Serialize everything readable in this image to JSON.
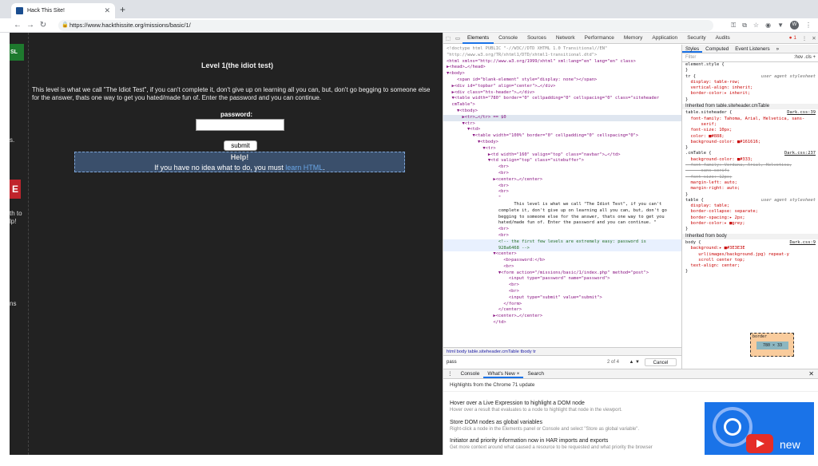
{
  "browser": {
    "tab_title": "Hack This Site!",
    "url": "https://www.hackthissite.org/missions/basic/1/"
  },
  "page": {
    "left_sl": "SL",
    "left_s": "s.",
    "left_e": "E",
    "left_th_to": "th to",
    "left_lp": "lp!",
    "left_ns": "ns",
    "title": "Level 1(the idiot test)",
    "body": "This level is what we call \"The Idiot Test\", if you can't complete it, don't give up on learning all you can, but, don't go begging to someone else for the answer, thats one way to get you hated/made fun of. Enter the password and you can continue.",
    "password_label": "password:",
    "submit_label": "submit",
    "help": "Help!",
    "idea_prefix": "If you have no idea what to do, you must ",
    "idea_link": "learn HTML",
    "idea_suffix": "."
  },
  "devtools": {
    "tabs": [
      "Elements",
      "Console",
      "Sources",
      "Network",
      "Performance",
      "Memory",
      "Application",
      "Security",
      "Audits"
    ],
    "error_count": "1",
    "dom_lines": [
      {
        "t": "<!doctype html PUBLIC \"-//W3C//DTD XHTML 1.0 Transitional//EN\"",
        "cls": "cm-grey"
      },
      {
        "t": "\"http://www.w3.org/TR/xhtml1/DTD/xhtml1-transitional.dtd\">",
        "cls": "cm-grey"
      },
      {
        "t": "<html xmlns=\"http://www.w3.org/1999/xhtml\" xml:lang=\"en\" lang=\"en\" class>"
      },
      {
        "t": "▶<head>…</head>"
      },
      {
        "t": "▼<body>"
      },
      {
        "t": "    <span id=\"blank-element\" style=\"display: none\"></span>"
      },
      {
        "t": "  ▶<div id=\"topbar\" align=\"center\">…</div>"
      },
      {
        "t": "  ▶<div class=\"hts-header\">…</div>"
      },
      {
        "t": "  ▼<table width=\"780\" border=\"0\" cellpadding=\"0\" cellspacing=\"0\" class=\"siteheader"
      },
      {
        "t": "  cmTable\">"
      },
      {
        "t": "    ▼<tbody>"
      },
      {
        "t": "      ▶<tr>…</tr> == $0",
        "sel": true
      },
      {
        "t": "      ▼<tr>"
      },
      {
        "t": "        ▼<td>"
      },
      {
        "t": "          ▼<table width=\"100%\" border=\"0\" cellpadding=\"0\" cellspacing=\"0\">"
      },
      {
        "t": "            ▼<tbody>"
      },
      {
        "t": "              ▼<tr>"
      },
      {
        "t": "                ▶<td width=\"160\" valign=\"top\" class=\"navbar\">…</td>"
      },
      {
        "t": "                ▼<td valign=\"top\" class=\"sitebuffer\">"
      },
      {
        "t": "                    <br>"
      },
      {
        "t": "                    <br>"
      },
      {
        "t": "                  ▶<center>…</center>"
      },
      {
        "t": "                    <br>"
      },
      {
        "t": "                    <br>"
      },
      {
        "t": "                    \""
      },
      {
        "t": ""
      },
      {
        "t": "                          This level is what we call \"The Idiot Test\", if you can't",
        "tx": true
      },
      {
        "t": "                    complete it, don't give up on learning all you can, but, don't go",
        "tx": true
      },
      {
        "t": "                    begging to someone else for the answer, thats one way to get you",
        "tx": true
      },
      {
        "t": "                    hated/made fun of. Enter the password and you can continue. \"",
        "tx": true
      },
      {
        "t": "                    <br>"
      },
      {
        "t": "                    <br>"
      },
      {
        "t": "                    <!-- the first few levels are extremely easy: password is",
        "cm": true,
        "hl": true
      },
      {
        "t": "                    928a6468 -->",
        "cm": true,
        "hl": true
      },
      {
        "t": "                  ▼<center>"
      },
      {
        "t": "                      <b>password:</b>"
      },
      {
        "t": "                      <br>"
      },
      {
        "t": "                    ▼<form action=\"/missions/basic/1/index.php\" method=\"post\">"
      },
      {
        "t": "                        <input type=\"password\" name=\"password\">"
      },
      {
        "t": "                        <br>"
      },
      {
        "t": "                        <br>"
      },
      {
        "t": "                        <input type=\"submit\" value=\"submit\">"
      },
      {
        "t": "                      </form>"
      },
      {
        "t": "                    </center>"
      },
      {
        "t": "                  ▶<center>…</center>"
      },
      {
        "t": "                  </td>"
      }
    ],
    "breadcrumbs": "html   body   table.siteheader.cmTable   tbody   tr",
    "search_value": "pass",
    "search_count": "2 of 4",
    "cancel_label": "Cancel",
    "styles_tabs": [
      "Styles",
      "Computed",
      "Event Listeners",
      "»"
    ],
    "filter_placeholder": "Filter",
    "filter_right": ":hov  .cls  +",
    "style_lines": [
      {
        "t": "element.style {"
      },
      {
        "t": "}"
      },
      {
        "t": "tr {",
        "ua": "user agent stylesheet"
      },
      {
        "t": "  display: table-row;",
        "p": true
      },
      {
        "t": "  vertical-align: inherit;",
        "p": true
      },
      {
        "t": "  border-color:▸ inherit;",
        "p": true
      },
      {
        "t": "}"
      },
      {
        "inh": "Inherited from table.siteheader.cmTable"
      },
      {
        "t": "table.siteheader {",
        "src": "Dark.css:39"
      },
      {
        "t": "  font-family: Tahoma, Arial, Helvetica, sans-",
        "p": true
      },
      {
        "t": "      serif;",
        "p": true
      },
      {
        "t": "  font-size: 10px;",
        "p": true
      },
      {
        "t": "  color: ■#888;",
        "p": true
      },
      {
        "t": "  background-color: ■#161616;",
        "p": true
      },
      {
        "t": "}"
      },
      {
        "t": ".cmTable {",
        "src": "Dark.css:237"
      },
      {
        "t": "  background-color: ■#333;",
        "p": true
      },
      {
        "t": "  font-family: Verdana, Arial, Helvetica,",
        "s": true
      },
      {
        "t": "      sans-serif;",
        "s": true
      },
      {
        "t": "  font-size: 12px;",
        "s": true
      },
      {
        "t": "  margin-left: auto;",
        "p": true
      },
      {
        "t": "  margin-right: auto;",
        "p": true
      },
      {
        "t": "}"
      },
      {
        "t": "table {",
        "ua": "user agent stylesheet"
      },
      {
        "t": "  display: table;",
        "p": true
      },
      {
        "t": "  border-collapse: separate;",
        "p": true
      },
      {
        "t": "  border-spacing:▸ 2px;",
        "p": true
      },
      {
        "t": "  border-color:▸ ■grey;",
        "p": true
      },
      {
        "t": "}"
      },
      {
        "inh": "Inherited from body"
      },
      {
        "t": "body {",
        "src": "Dark.css:9"
      },
      {
        "t": "  background:▸ ■#3E3E3E",
        "p": true
      },
      {
        "t": "     url(images/background.jpg) repeat-y",
        "p": true
      },
      {
        "t": "     scroll center top;",
        "p": true
      },
      {
        "t": "  text-align: center;",
        "p": true
      },
      {
        "t": "}"
      }
    ],
    "box_label": "border",
    "box_dims": "780 × 33"
  },
  "drawer": {
    "tabs": [
      "Console",
      "What's New ×",
      "Search"
    ],
    "heading": "Highlights from the Chrome 71 update",
    "items": [
      {
        "h": "Hover over a Live Expression to highlight a DOM node",
        "d": "Hover over a result that evaluates to a node to highlight that node in the viewport."
      },
      {
        "h": "Store DOM nodes as global variables",
        "d": "Right-click a node in the Elements panel or Console and select \"Store as global variable\"."
      },
      {
        "h": "Initiator and priority information now in HAR imports and exports",
        "d": "Get more context around what caused a resource to be requested and what priority the browser"
      }
    ],
    "new_badge": "new"
  }
}
